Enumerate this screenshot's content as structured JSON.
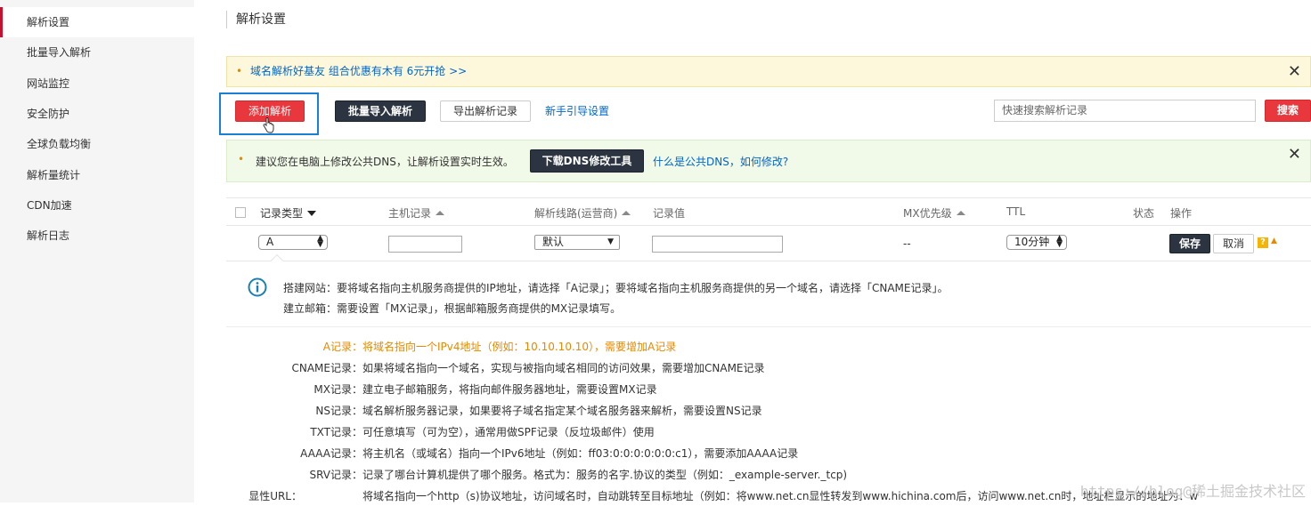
{
  "sidebar": {
    "items": [
      {
        "label": "解析设置",
        "active": true
      },
      {
        "label": "批量导入解析"
      },
      {
        "label": "网站监控"
      },
      {
        "label": "安全防护"
      },
      {
        "label": "全球负载均衡"
      },
      {
        "label": "解析量统计"
      },
      {
        "label": "CDN加速"
      },
      {
        "label": "解析日志"
      }
    ]
  },
  "page": {
    "title": "解析设置"
  },
  "promo": {
    "text": "域名解析好基友 组合优惠有木有 6元开抢 >>"
  },
  "toolbar": {
    "add_label": "添加解析",
    "batch_label": "批量导入解析",
    "export_label": "导出解析记录",
    "guide_label": "新手引导设置",
    "search_placeholder": "快速搜索解析记录",
    "search_button": "搜索"
  },
  "tip": {
    "text": "建议您在电脑上修改公共DNS，让解析设置实时生效。",
    "download_label": "下载DNS修改工具",
    "link": "什么是公共DNS，如何修改?"
  },
  "table": {
    "headers": {
      "type": "记录类型",
      "host": "主机记录",
      "line": "解析线路(运营商)",
      "value": "记录值",
      "mx": "MX优先级",
      "ttl": "TTL",
      "status": "状态",
      "action": "操作"
    },
    "edit_row": {
      "type": "A",
      "line": "默认",
      "mx": "--",
      "ttl": "10分钟",
      "save": "保存",
      "cancel": "取消"
    }
  },
  "help": {
    "line1": "搭建网站：要将域名指向主机服务商提供的IP地址，请选择「A记录」；要将域名指向主机服务商提供的另一个域名，请选择「CNAME记录」。",
    "line2": "建立邮箱：需要设置「MX记录」，根据邮箱服务商提供的MX记录填写。",
    "records": [
      {
        "key": "A记录：",
        "desc": "将域名指向一个IPv4地址（例如：10.10.10.10），需要增加A记录"
      },
      {
        "key": "CNAME记录：",
        "desc": "如果将域名指向一个域名，实现与被指向域名相同的访问效果，需要增加CNAME记录"
      },
      {
        "key": "MX记录：",
        "desc": "建立电子邮箱服务，将指向邮件服务器地址，需要设置MX记录"
      },
      {
        "key": "NS记录：",
        "desc": "域名解析服务器记录，如果要将子域名指定某个域名服务器来解析，需要设置NS记录"
      },
      {
        "key": "TXT记录：",
        "desc": "可任意填写（可为空），通常用做SPF记录（反垃圾邮件）使用"
      },
      {
        "key": "AAAA记录：",
        "desc": "将主机名（或域名）指向一个IPv6地址（例如：ff03:0:0:0:0:0:0:c1），需要添加AAAA记录"
      },
      {
        "key": "SRV记录：",
        "desc": "记录了哪台计算机提供了哪个服务。格式为：服务的名字.协议的类型（例如：_example-server._tcp)"
      },
      {
        "key": "显性URL：",
        "desc": "将域名指向一个http（s)协议地址，访问域名时，自动跳转至目标地址（例如：将www.net.cn显性转发到www.hichina.com后，访问www.net.cn时，地址栏显示的地址为：w"
      }
    ]
  },
  "watermark": "https://blog@稀土掘金技术社区",
  "colors": {
    "accent_red": "#e8383d",
    "link_blue": "#0066cc",
    "highlight": "#e58a00",
    "dark_btn": "#2b3440"
  }
}
